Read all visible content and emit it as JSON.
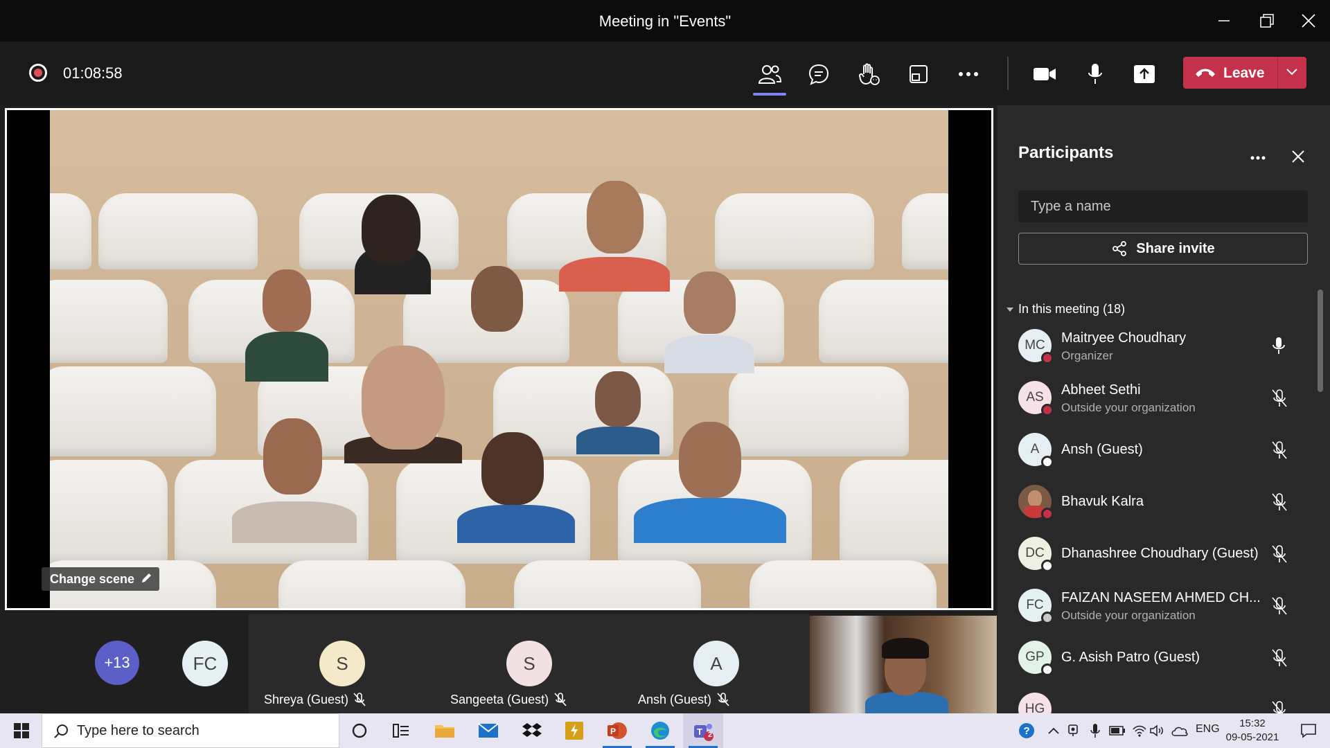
{
  "window": {
    "title": "Meeting in \"Events\""
  },
  "toolbar": {
    "timer": "01:08:58",
    "leave_label": "Leave"
  },
  "stage": {
    "change_scene_label": "Change scene"
  },
  "strip": {
    "overflow_count": "+13",
    "tiles": [
      {
        "initials": "FC",
        "name": ""
      },
      {
        "initials": "S",
        "name": "Shreya (Guest)"
      },
      {
        "initials": "S",
        "name": "Sangeeta (Guest)"
      },
      {
        "initials": "A",
        "name": "Ansh (Guest)"
      }
    ]
  },
  "panel": {
    "title": "Participants",
    "search_placeholder": "Type a name",
    "share_label": "Share invite",
    "section_label": "In this meeting (18)",
    "participants": [
      {
        "initials": "MC",
        "name": "Maitryee Choudhary",
        "sub": "Organizer",
        "status_color": "#c4314b",
        "mic": "on",
        "avatar_bg": "#e4eef3"
      },
      {
        "initials": "AS",
        "name": "Abheet Sethi",
        "sub": "Outside your organization",
        "status_color": "#c4314b",
        "mic": "muted",
        "avatar_bg": "#f6e1e6"
      },
      {
        "initials": "A",
        "name": "Ansh (Guest)",
        "sub": "",
        "status_color": "#ffffff",
        "mic": "muted",
        "avatar_bg": "#e4eef3"
      },
      {
        "initials": "",
        "name": "Bhavuk Kalra",
        "sub": "",
        "status_color": "#c4314b",
        "mic": "muted",
        "avatar_bg": "#7a5a45"
      },
      {
        "initials": "DC",
        "name": "Dhanashree Choudhary (Guest)",
        "sub": "",
        "status_color": "#ffffff",
        "mic": "muted",
        "avatar_bg": "#eef0e1"
      },
      {
        "initials": "FC",
        "name": "FAIZAN NASEEM AHMED CH...",
        "sub": "Outside your organization",
        "status_color": "#c8c8c8",
        "mic": "muted",
        "avatar_bg": "#e4f0f2"
      },
      {
        "initials": "GP",
        "name": "G. Asish Patro (Guest)",
        "sub": "",
        "status_color": "#ffffff",
        "mic": "muted",
        "avatar_bg": "#e3f2e6"
      },
      {
        "initials": "HG",
        "name": "",
        "sub": "",
        "status_color": "#ffffff",
        "mic": "muted",
        "avatar_bg": "#f6e1e6"
      }
    ]
  },
  "taskbar": {
    "search_placeholder": "Type here to search",
    "language": "ENG",
    "time": "15:32",
    "date": "09-05-2021",
    "teams_badge": "2"
  }
}
